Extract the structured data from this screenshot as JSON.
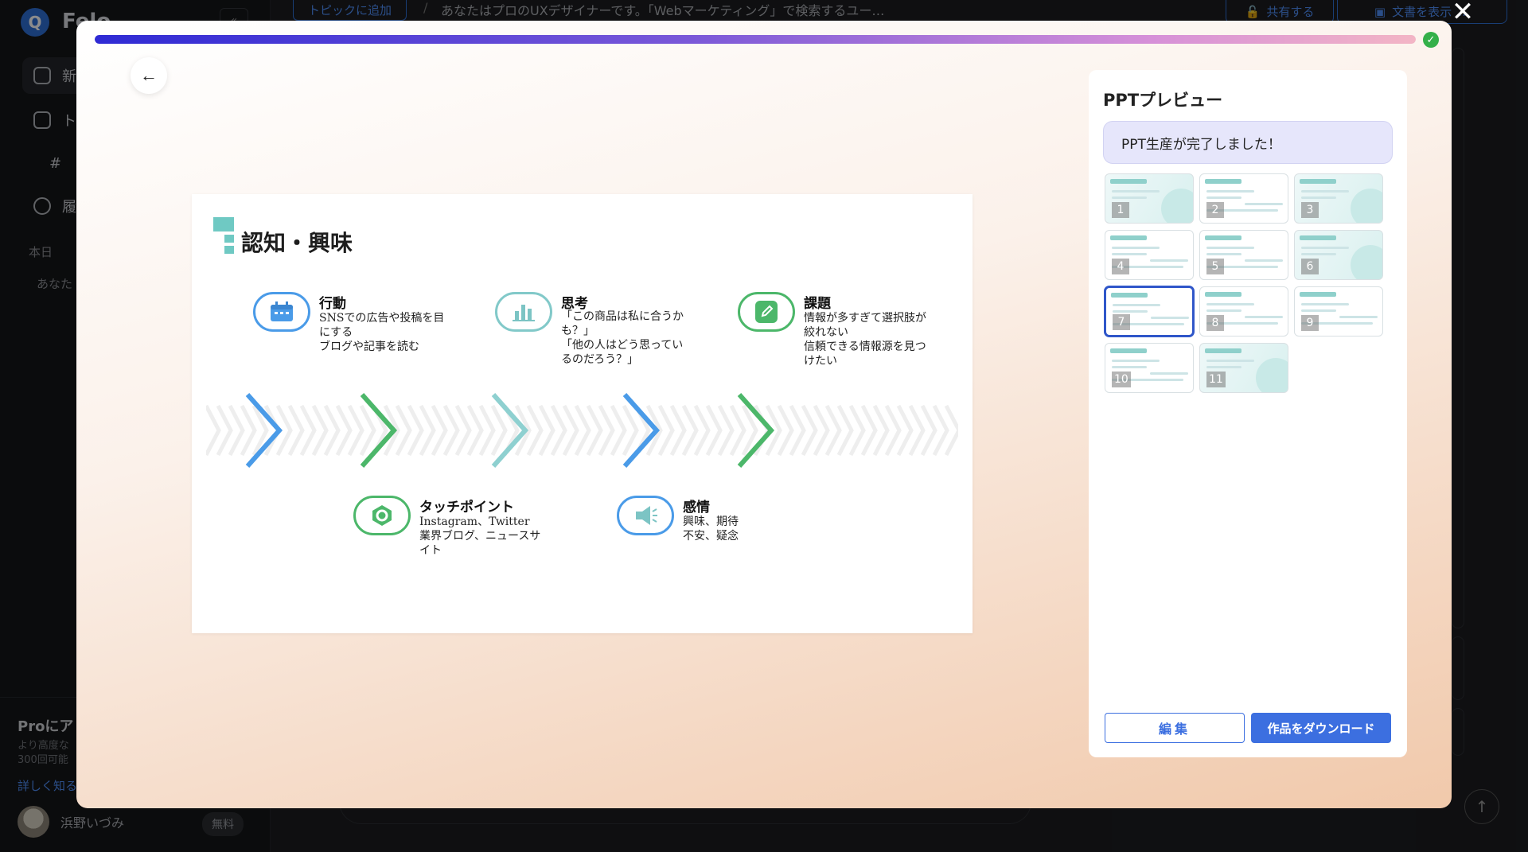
{
  "background": {
    "brand": "Felo",
    "logo_glyph": "Q",
    "nav": [
      {
        "label": "新",
        "icon": "new-chat-icon"
      },
      {
        "label": "ト",
        "icon": "bookmark-icon"
      },
      {
        "label": "#",
        "icon": "hash-icon"
      },
      {
        "label": "履",
        "icon": "history-icon"
      }
    ],
    "section_today": "本日",
    "history_item": "あなた",
    "pro_title": "Proにア",
    "pro_desc": "より高度な\n300回可能",
    "pro_link": "詳しく知る",
    "username": "浜野いづみ",
    "plan": "無料",
    "crumb_button": "トピックに追加",
    "crumb_sep": "/",
    "crumb_text": "あなたはプロのUXデザイナーです。「Webマーケティング」で検索するユー…",
    "share_label": "共有する",
    "doc_label": "文書を表示",
    "more_label": "…"
  },
  "modal": {
    "progress_percent": 100,
    "close_glyph": "✕",
    "back_glyph": "←",
    "check_glyph": "✓",
    "slide": {
      "title": "認知・興味",
      "items": [
        {
          "title": "行動",
          "text": "SNSでの広告や投稿を目\nにする\nブログや記事を読む",
          "icon": "calendar-icon",
          "color": "#4a9be8"
        },
        {
          "title": "思考",
          "text": "「この商品は私に合うか\nも？」\n「他の人はどう思ってい\nるのだろう？」",
          "icon": "bar-chart-icon",
          "color": "#82c9c9"
        },
        {
          "title": "課題",
          "text": "情報が多すぎて選択肢が\n絞れない\n信頼できる情報源を見つ\nけたい",
          "icon": "edit-icon",
          "color": "#4cb76a"
        },
        {
          "title": "タッチポイント",
          "text": "Instagram、Twitter\n業界ブログ、ニュースサ\nイト",
          "icon": "target-icon",
          "color": "#4cb76a"
        },
        {
          "title": "感情",
          "text": "興味、期待\n不安、疑念",
          "icon": "megaphone-icon",
          "color": "#4a9be8"
        }
      ],
      "chevron_colors": [
        "#4a9be8",
        "#4cb76a",
        "#8ed0d0",
        "#4a9be8",
        "#4cb76a"
      ]
    },
    "panel": {
      "title": "PPTプレビュー",
      "message": "PPT生産が完了しました！",
      "thumbnails": [
        {
          "num": "1",
          "style": "teal"
        },
        {
          "num": "2",
          "style": "plain"
        },
        {
          "num": "3",
          "style": "teal"
        },
        {
          "num": "4",
          "style": "plain"
        },
        {
          "num": "5",
          "style": "plain"
        },
        {
          "num": "6",
          "style": "teal"
        },
        {
          "num": "7",
          "style": "plain",
          "active": true
        },
        {
          "num": "8",
          "style": "plain"
        },
        {
          "num": "9",
          "style": "plain"
        },
        {
          "num": "10",
          "style": "plain"
        },
        {
          "num": "11",
          "style": "teal"
        }
      ],
      "edit_label": "編集",
      "download_label": "作品をダウンロード"
    }
  }
}
